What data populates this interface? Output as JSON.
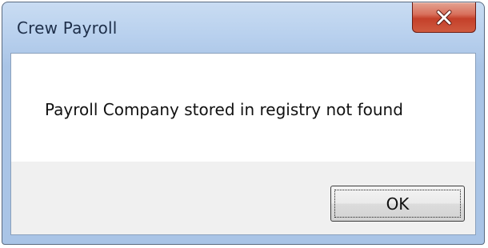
{
  "window": {
    "title": "Crew Payroll"
  },
  "titlebar": {
    "close_icon": "close-icon"
  },
  "dialog": {
    "message": "Payroll Company stored in registry not found",
    "ok_label": "OK"
  },
  "colors": {
    "frame": "#a9c4e6",
    "close_button": "#c4402a",
    "button_area": "#f0f0f0"
  }
}
